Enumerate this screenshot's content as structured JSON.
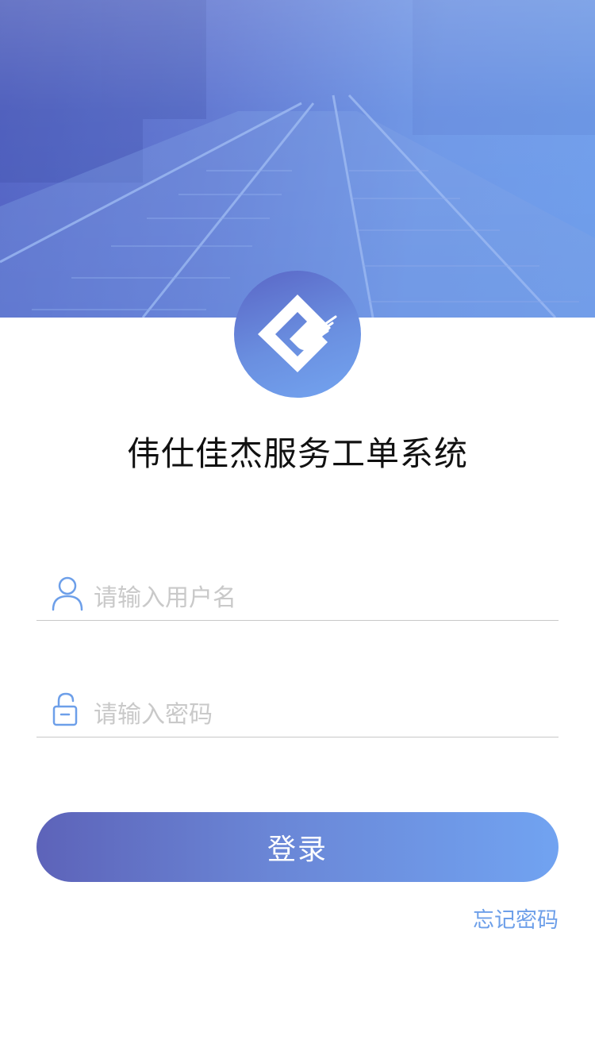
{
  "header": {
    "image_desc_colors": {
      "start": "#4f5fc2",
      "end": "#6c9ceb"
    },
    "logo_icon": "e-ticket-logo-icon"
  },
  "app": {
    "title": "伟仕佳杰服务工单系统"
  },
  "form": {
    "username": {
      "placeholder": "请输入用户名",
      "value": "",
      "icon": "user-icon"
    },
    "password": {
      "placeholder": "请输入密码",
      "value": "",
      "icon": "lock-icon"
    },
    "login_label": "登录",
    "forgot_label": "忘记密码"
  },
  "colors": {
    "accent": "#6d9fe9",
    "button_start": "#5d63b9",
    "button_end": "#71a3f1",
    "title": "#111111",
    "placeholder": "#c9c9c9"
  }
}
